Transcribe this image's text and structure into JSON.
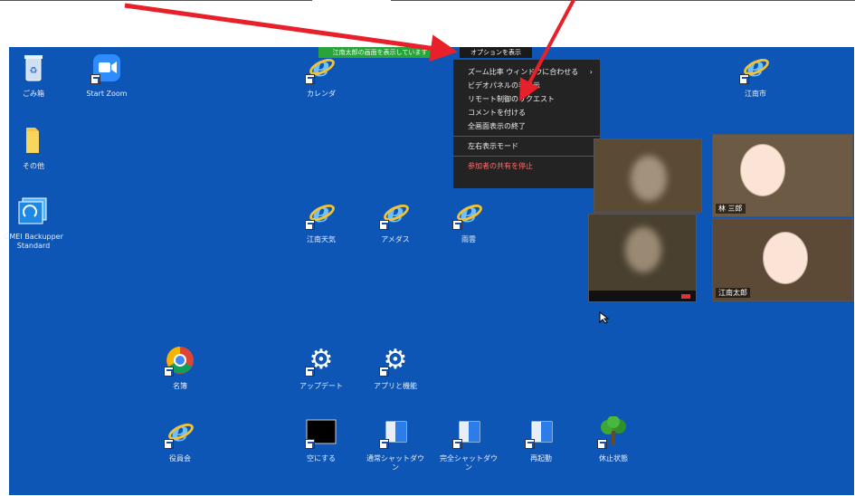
{
  "desktop_icons": {
    "recycle": "ごみ箱",
    "start_zoom": "Start Zoom",
    "calendar": "カレンダ",
    "koudai": "江南市",
    "other": "その他",
    "backupper": "OMEI Backupper Standard",
    "weather": "江南天気",
    "amedas": "アメダス",
    "radar": "雨雲",
    "chrome": "名簿",
    "update": "アップデート",
    "apps": "アプリと機能",
    "blank": "空にする",
    "shutdown_normal": "通常シャットダウン",
    "shutdown_full": "完全シャットダウン",
    "restart": "再起動",
    "sleep": "休止状態",
    "bottom_ie": "役員会"
  },
  "share_bar": "江南太郎の画面を表示しています",
  "options_button": "オプションを表示",
  "menu_items": [
    "ズーム比率 ウィンドウに合わせる",
    "ビデオパネルの非表示",
    "リモート制御のリクエスト",
    "コメントを付ける",
    "全画面表示の終了",
    "左右表示モード",
    "参加者の共有を停止"
  ],
  "menu_chevron": "›",
  "video_names": [
    "林 三郎",
    "江南太郎"
  ],
  "colors": {
    "desktop": "#0d56b5",
    "arrow": "#e8202a",
    "share_bar": "#29a33b",
    "menu_bg": "#232323"
  }
}
